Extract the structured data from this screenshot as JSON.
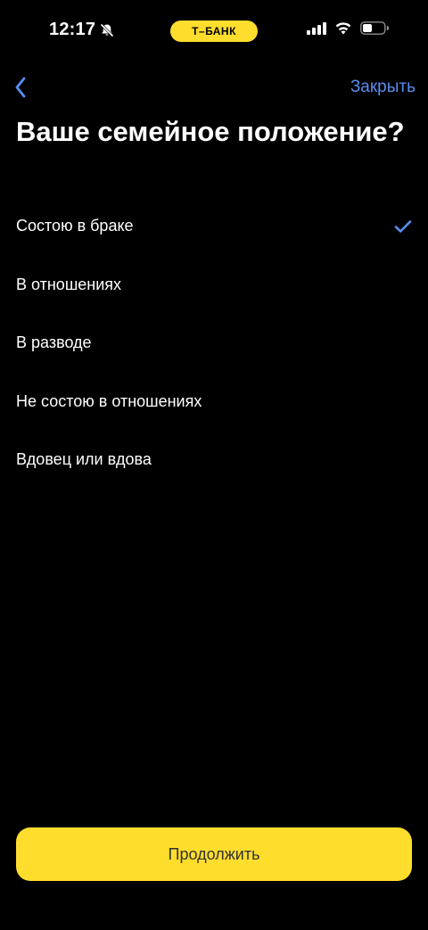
{
  "status_bar": {
    "time": "12:17",
    "carrier": "Т–БАНК",
    "icons": [
      "bell-slash-icon",
      "cellular-signal-icon",
      "wifi-icon",
      "battery-icon"
    ]
  },
  "nav": {
    "back_icon": "chevron-left-icon",
    "close_label": "Закрыть"
  },
  "title": "Ваше семейное положение?",
  "options": [
    {
      "label": "Состою в браке",
      "selected": true
    },
    {
      "label": "В отношениях",
      "selected": false
    },
    {
      "label": "В разводе",
      "selected": false
    },
    {
      "label": "Не состою в отношениях",
      "selected": false
    },
    {
      "label": "Вдовец или вдова",
      "selected": false
    }
  ],
  "continue_label": "Продолжить",
  "colors": {
    "accent": "#ffdd2d",
    "link": "#5b8def",
    "background": "#000000"
  }
}
